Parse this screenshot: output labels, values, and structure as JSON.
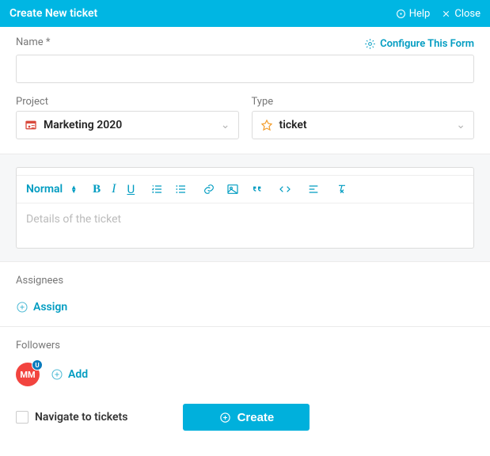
{
  "header": {
    "title": "Create New ticket",
    "help": "Help",
    "close": "Close"
  },
  "form": {
    "name_label": "Name *",
    "configure": "Configure This Form",
    "name_value": "",
    "project_label": "Project",
    "project_value": "Marketing 2020",
    "type_label": "Type",
    "type_value": "ticket"
  },
  "editor": {
    "format": "Normal",
    "placeholder": "Details of the ticket"
  },
  "assignees": {
    "label": "Assignees",
    "assign": "Assign"
  },
  "followers": {
    "label": "Followers",
    "avatar_initials": "MM",
    "avatar_badge": "U",
    "add": "Add"
  },
  "footer": {
    "navigate": "Navigate to tickets",
    "create": "Create"
  }
}
